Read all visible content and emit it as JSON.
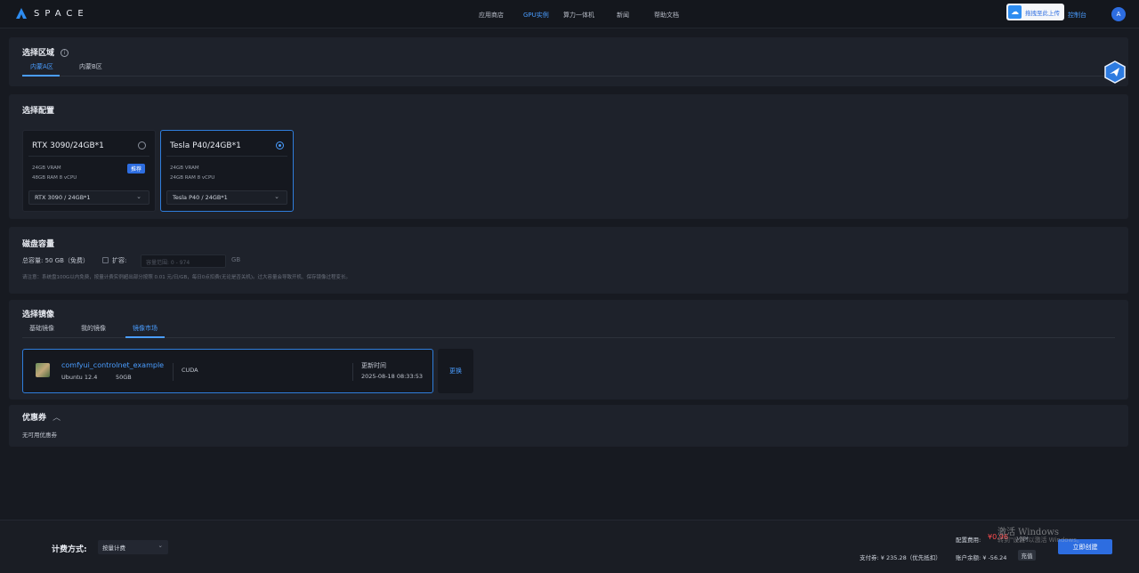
{
  "header": {
    "brand": "SPACE",
    "nav": [
      {
        "label": "应用商店",
        "active": false
      },
      {
        "label": "GPU实例",
        "active": true
      },
      {
        "label": "算力一体机",
        "active": false
      },
      {
        "label": "新闻",
        "active": false
      },
      {
        "label": "帮助文档",
        "active": false
      }
    ],
    "upload_label": "拖拽至此上传",
    "console_label": "控制台",
    "avatar_letter": "A"
  },
  "region": {
    "title": "选择区域",
    "tabs": [
      {
        "label": "内蒙A区",
        "active": true
      },
      {
        "label": "内蒙B区",
        "active": false
      }
    ]
  },
  "config": {
    "title": "选择配置",
    "cards": [
      {
        "name": "RTX 3090/24GB*1",
        "vram": "24GB VRAM",
        "ram": "48GB RAM 8 vCPU",
        "badge": "推荐",
        "select": "RTX 3090 / 24GB*1",
        "selected": false
      },
      {
        "name": "Tesla P40/24GB*1",
        "vram": "24GB VRAM",
        "ram": "24GB RAM 8 vCPU",
        "badge": "",
        "select": "Tesla P40 / 24GB*1",
        "selected": true
      }
    ]
  },
  "disk": {
    "title": "磁盘容量",
    "total": "总容量: 50 GB（免费）",
    "expand_label": "扩容:",
    "expand_placeholder": "容量范围: 0 - 974",
    "unit": "GB",
    "note": "请注意：系统盘100G以内免费，按量计费实例超出部分按照 0.01 元/日/GB，每日0点扣费(无论是否关机)。过大容量会导致开机、保存镜像过程变长。"
  },
  "image": {
    "title": "选择镜像",
    "tabs": [
      {
        "label": "基础镜像",
        "active": false
      },
      {
        "label": "我的镜像",
        "active": false
      },
      {
        "label": "镜像市场",
        "active": true
      }
    ],
    "selected": {
      "name": "comfyui_controlnet_example",
      "os": "Ubuntu 12.4",
      "size": "50GB",
      "tag": "CUDA",
      "updated_label": "更新时间",
      "updated_value": "2025-08-18 08:33:53"
    },
    "change_label": "更换"
  },
  "coupon": {
    "title": "优惠券",
    "empty": "无可用优惠券"
  },
  "footer": {
    "billing_label": "计费方式:",
    "billing_value": "按量计费",
    "config_fee_label": "配置费用:",
    "config_fee_value": "¥0.96",
    "config_fee_unit": "/小时",
    "pay_label": "支付券: ¥ 235.28（优先抵扣）",
    "balance_label": "账户余额: ¥ -56.24",
    "recharge_label": "充值",
    "create_label": "立即创建"
  },
  "watermark": {
    "line1": "激活 Windows",
    "line2": "转到\"设置\"以激活 Windows。"
  },
  "colors": {
    "accent": "#4a9dff",
    "primary_button": "#2d6de0",
    "price": "#ff4d4f"
  }
}
